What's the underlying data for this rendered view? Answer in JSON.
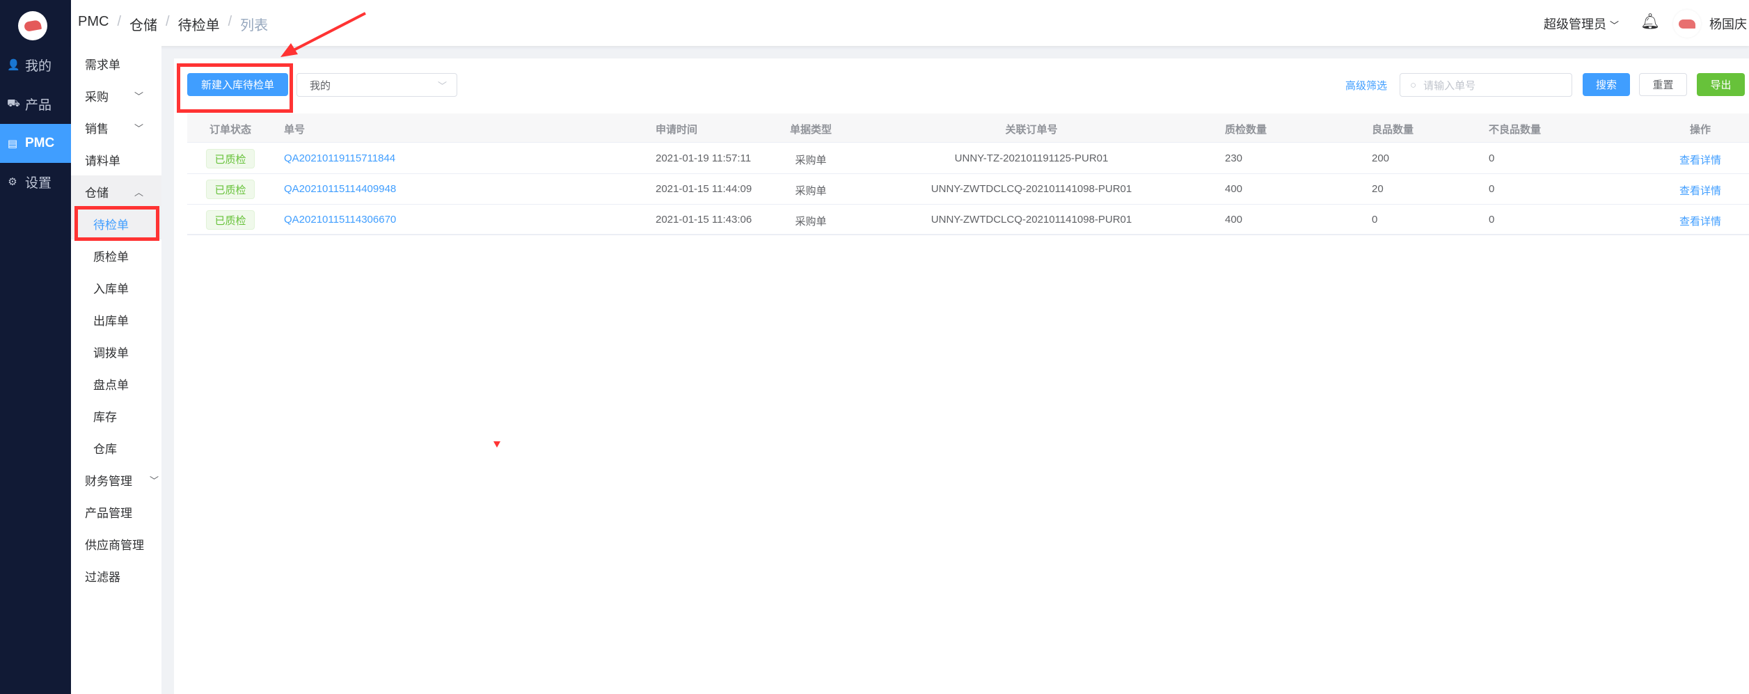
{
  "nav": {
    "items": [
      {
        "label": "我的",
        "icon": "user-icon"
      },
      {
        "label": "产品",
        "icon": "truck-icon"
      },
      {
        "label": "PMC",
        "icon": "clipboard-icon",
        "active": true
      },
      {
        "label": "设置",
        "icon": "gear-icon"
      }
    ]
  },
  "breadcrumb": [
    "PMC",
    "仓储",
    "待检单",
    "列表"
  ],
  "header": {
    "role": "超级管理员",
    "user": "杨国庆"
  },
  "subnav": [
    {
      "label": "需求单"
    },
    {
      "label": "采购",
      "chev": "⌄"
    },
    {
      "label": "销售",
      "chev": "⌄"
    },
    {
      "label": "请料单"
    },
    {
      "label": "仓储",
      "chev": "⌃",
      "open": true
    },
    {
      "label": "待检单",
      "child": true,
      "current": true
    },
    {
      "label": "质检单",
      "child": true
    },
    {
      "label": "入库单",
      "child": true
    },
    {
      "label": "出库单",
      "child": true
    },
    {
      "label": "调拨单",
      "child": true
    },
    {
      "label": "盘点单",
      "child": true
    },
    {
      "label": "库存",
      "child": true
    },
    {
      "label": "仓库",
      "child": true
    },
    {
      "label": "财务管理",
      "chev": "⌄"
    },
    {
      "label": "产品管理"
    },
    {
      "label": "供应商管理"
    },
    {
      "label": "过滤器"
    }
  ],
  "toolbar": {
    "new_label": "新建入库待检单",
    "filter_select": "我的",
    "advanced": "高级筛选",
    "search_placeholder": "请输入单号",
    "search": "搜索",
    "reset": "重置",
    "export": "导出"
  },
  "table": {
    "headers": [
      "订单状态",
      "单号",
      "申请时间",
      "单据类型",
      "关联订单号",
      "质检数量",
      "良品数量",
      "不良品数量",
      "操作"
    ],
    "rows": [
      [
        "已质检",
        "QA20210119115711844",
        "2021-01-19 11:57:11",
        "采购单",
        "UNNY-TZ-202101191125-PUR01",
        "230",
        "200",
        "0",
        "查看详情"
      ],
      [
        "已质检",
        "QA20210115114409948",
        "2021-01-15 11:44:09",
        "采购单",
        "UNNY-ZWTDCLCQ-202101141098-PUR01",
        "400",
        "20",
        "0",
        "查看详情"
      ],
      [
        "已质检",
        "QA20210115114306670",
        "2021-01-15 11:43:06",
        "采购单",
        "UNNY-ZWTDCLCQ-202101141098-PUR01",
        "400",
        "0",
        "0",
        "查看详情"
      ]
    ]
  },
  "colors": {
    "primary": "#409eff",
    "sidebar": "#111a35",
    "success": "#67c23a",
    "annotation": "#ff3333"
  }
}
